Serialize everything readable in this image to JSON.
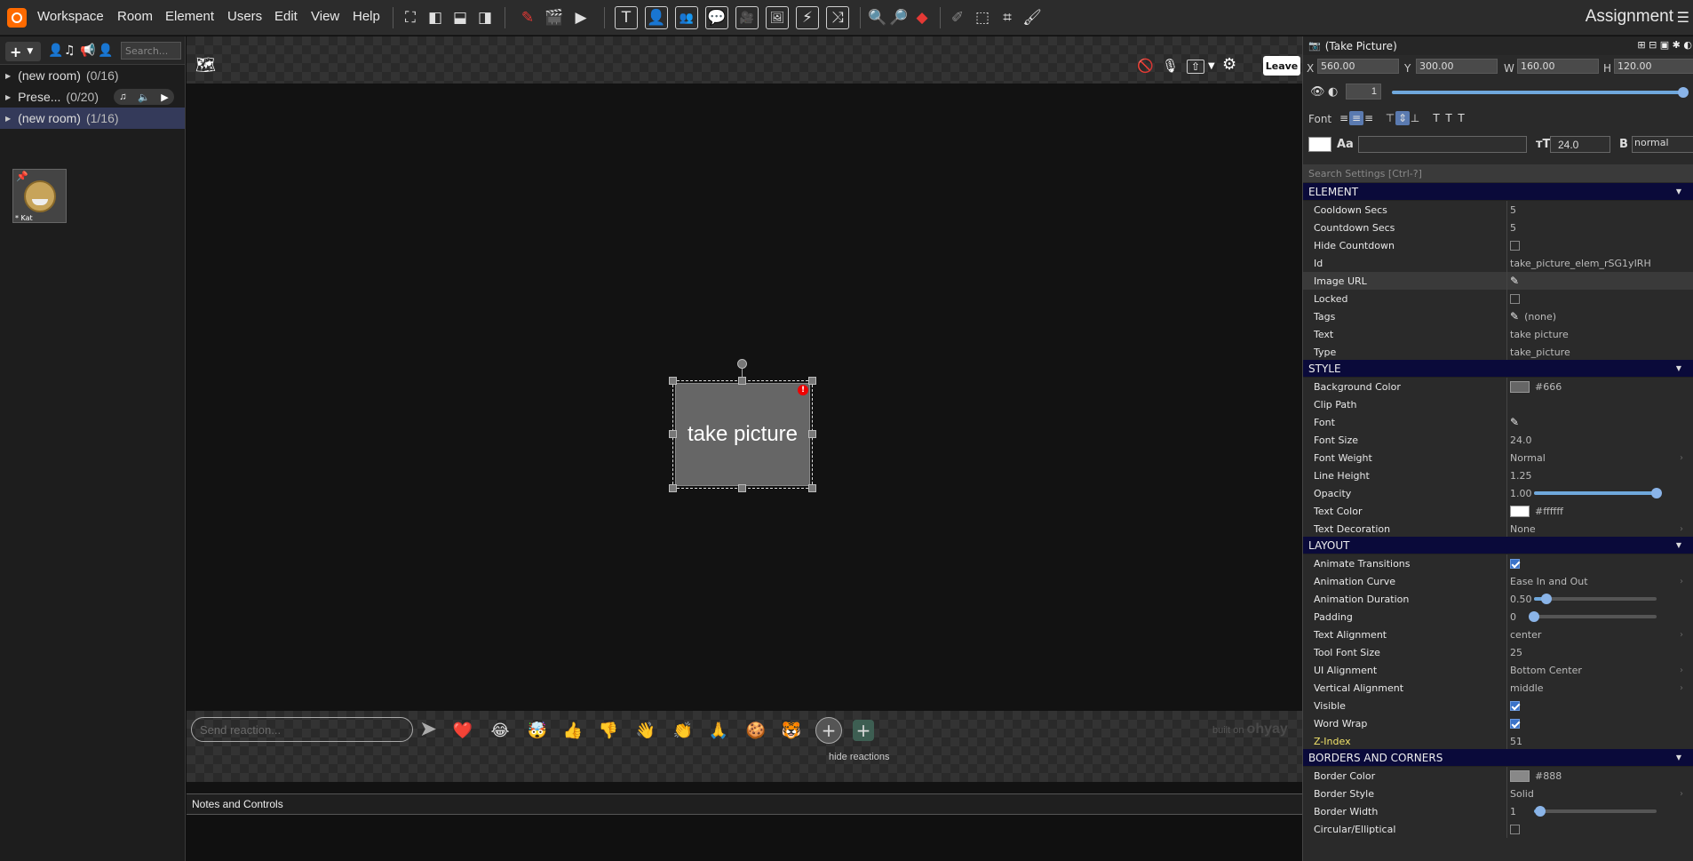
{
  "menu": {
    "items": [
      "Workspace",
      "Room",
      "Element",
      "Users",
      "Edit",
      "View",
      "Help"
    ],
    "right_title": "Assignment"
  },
  "sidebar": {
    "search_placeholder": "Search...",
    "rooms": [
      {
        "name": "(new room)",
        "count": "(0/16)"
      },
      {
        "name": "Prese...",
        "count": "(0/20)"
      },
      {
        "name": "(new room)",
        "count": "(1/16)"
      }
    ],
    "user_tile_name": "* Kat"
  },
  "stage": {
    "leave_label": "Leave",
    "element_text": "take picture",
    "reaction_placeholder": "Send reaction...",
    "hide_reactions_label": "hide reactions",
    "built_on_prefix": "built on",
    "built_on_brand": "ohyay",
    "notes_title": "Notes and Controls"
  },
  "panel": {
    "title": "(Take Picture)",
    "geometry": {
      "x_label": "X",
      "x": "560.00",
      "y_label": "Y",
      "y": "300.00",
      "w_label": "W",
      "w": "160.00",
      "h_label": "H",
      "h": "120.00"
    },
    "layer": "1",
    "opacity_fraction": 1.0,
    "font_label": "Font",
    "aa_label": "Aa",
    "font_size": "24.0",
    "bold_label": "B",
    "font_weight_short": "normal",
    "search_placeholder": "Search Settings [Ctrl-?]",
    "sections": {
      "element": {
        "title": "ELEMENT",
        "rows": {
          "cooldown": {
            "label": "Cooldown Secs",
            "value": "5"
          },
          "countdown": {
            "label": "Countdown Secs",
            "value": "5"
          },
          "hide_countdown": {
            "label": "Hide Countdown",
            "checked": false
          },
          "id": {
            "label": "Id",
            "value": "take_picture_elem_rSG1yIRH"
          },
          "image_url": {
            "label": "Image URL"
          },
          "locked": {
            "label": "Locked",
            "checked": false
          },
          "tags": {
            "label": "Tags",
            "value": "(none)"
          },
          "text": {
            "label": "Text",
            "value": "take picture"
          },
          "type": {
            "label": "Type",
            "value": "take_picture"
          }
        }
      },
      "style": {
        "title": "STYLE",
        "rows": {
          "bg_color": {
            "label": "Background Color",
            "value": "#666",
            "swatch": "#666666"
          },
          "clip_path": {
            "label": "Clip Path"
          },
          "font": {
            "label": "Font"
          },
          "font_size": {
            "label": "Font Size",
            "value": "24.0"
          },
          "font_weight": {
            "label": "Font Weight",
            "value": "Normal"
          },
          "line_height": {
            "label": "Line Height",
            "value": "1.25"
          },
          "opacity": {
            "label": "Opacity",
            "value": "1.00",
            "fraction": 1.0
          },
          "text_color": {
            "label": "Text Color",
            "value": "#ffffff",
            "swatch": "#ffffff"
          },
          "text_decoration": {
            "label": "Text Decoration",
            "value": "None"
          }
        }
      },
      "layout": {
        "title": "LAYOUT",
        "rows": {
          "animate": {
            "label": "Animate Transitions",
            "checked": true
          },
          "curve": {
            "label": "Animation Curve",
            "value": "Ease In and Out"
          },
          "duration": {
            "label": "Animation Duration",
            "value": "0.50",
            "fraction": 0.1
          },
          "padding": {
            "label": "Padding",
            "value": "0",
            "fraction": 0.0
          },
          "text_align": {
            "label": "Text Alignment",
            "value": "center"
          },
          "tool_font": {
            "label": "Tool Font Size",
            "value": "25"
          },
          "ui_align": {
            "label": "UI Alignment",
            "value": "Bottom Center"
          },
          "vert_align": {
            "label": "Vertical Alignment",
            "value": "middle"
          },
          "visible": {
            "label": "Visible",
            "checked": true
          },
          "word_wrap": {
            "label": "Word Wrap",
            "checked": true
          },
          "z_index": {
            "label": "Z-Index",
            "value": "51"
          }
        }
      },
      "borders": {
        "title": "BORDERS AND CORNERS",
        "rows": {
          "border_color": {
            "label": "Border Color",
            "value": "#888",
            "swatch": "#888888"
          },
          "border_style": {
            "label": "Border Style",
            "value": "Solid"
          },
          "border_width": {
            "label": "Border Width",
            "value": "1",
            "fraction": 0.05
          },
          "circular": {
            "label": "Circular/Elliptical",
            "checked": false
          }
        }
      }
    }
  },
  "colors": {
    "accent": "#ff6a00",
    "section": "#0a0a3a",
    "slider": "#6fa8dc"
  }
}
